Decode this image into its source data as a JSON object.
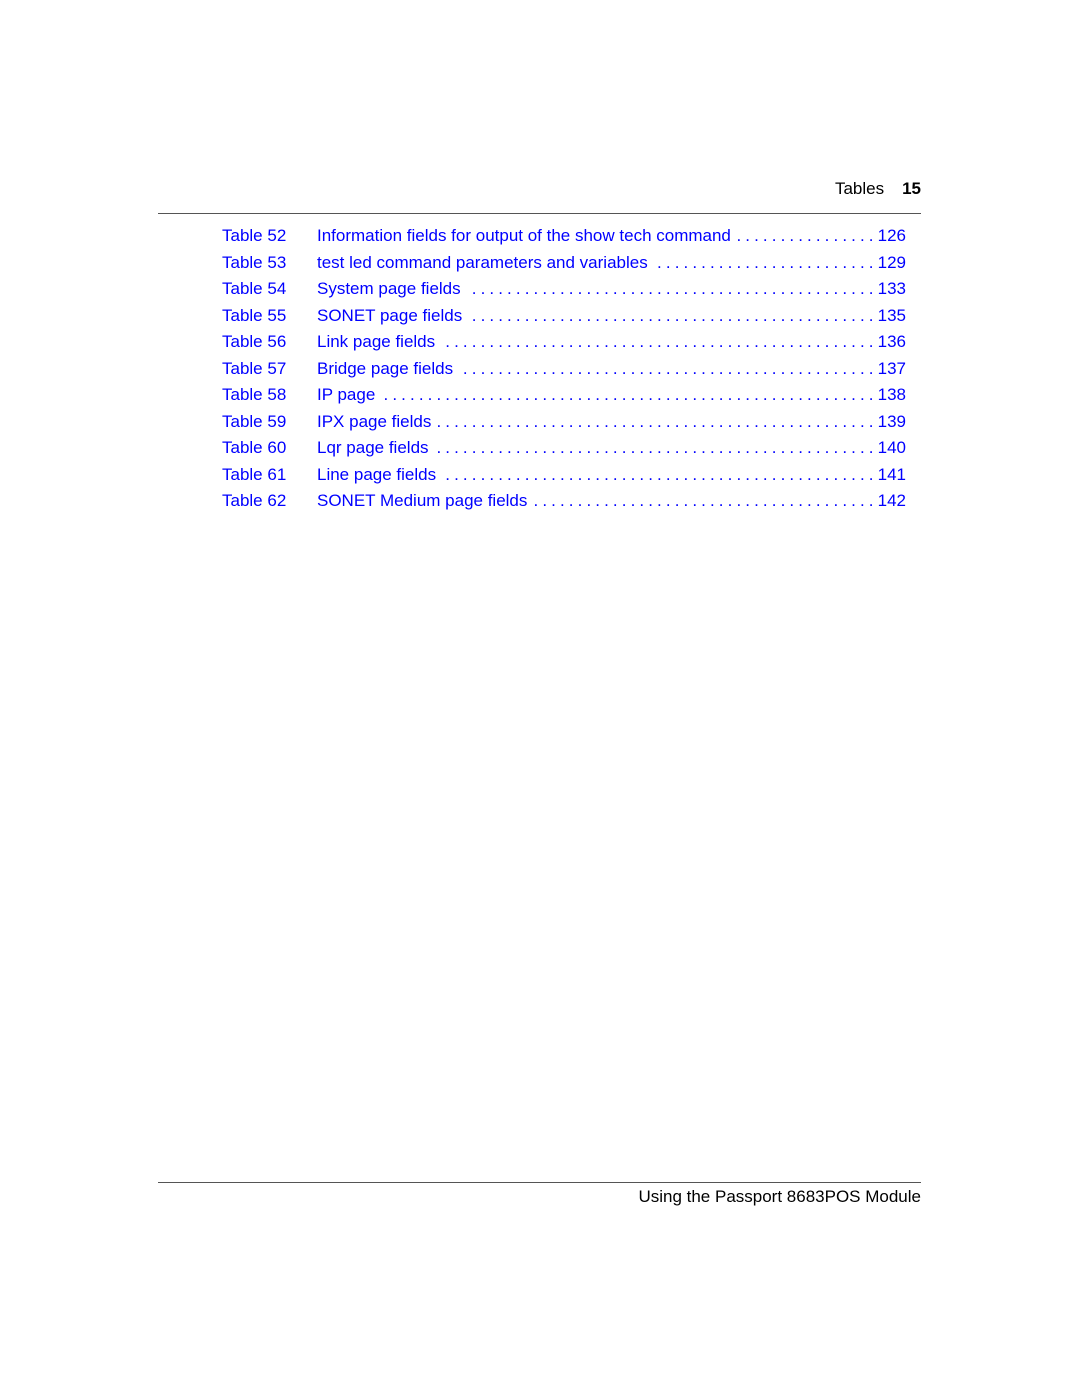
{
  "header": {
    "section": "Tables",
    "page_number": "15"
  },
  "toc": {
    "entries": [
      {
        "label": "Table 52",
        "title": "Information fields for output of the show tech command",
        "page": "126"
      },
      {
        "label": "Table 53",
        "title": "test led command parameters and variables",
        "page": "129"
      },
      {
        "label": "Table 54",
        "title": "System page fields",
        "page": "133"
      },
      {
        "label": "Table 55",
        "title": "SONET page fields",
        "page": "135"
      },
      {
        "label": "Table 56",
        "title": "Link page fields",
        "page": "136"
      },
      {
        "label": "Table 57",
        "title": "Bridge page fields",
        "page": "137"
      },
      {
        "label": "Table 58",
        "title": "IP page",
        "page": "138"
      },
      {
        "label": "Table 59",
        "title": "IPX page fields",
        "page": "139"
      },
      {
        "label": "Table 60",
        "title": "Lqr page fields",
        "page": "140"
      },
      {
        "label": "Table 61",
        "title": "Line page fields",
        "page": "141"
      },
      {
        "label": "Table 62",
        "title": "SONET Medium page fields",
        "page": "142"
      }
    ],
    "leader_char": ".",
    "link_color": "#0000ff"
  },
  "footer": {
    "text": "Using the Passport 8683POS Module"
  }
}
